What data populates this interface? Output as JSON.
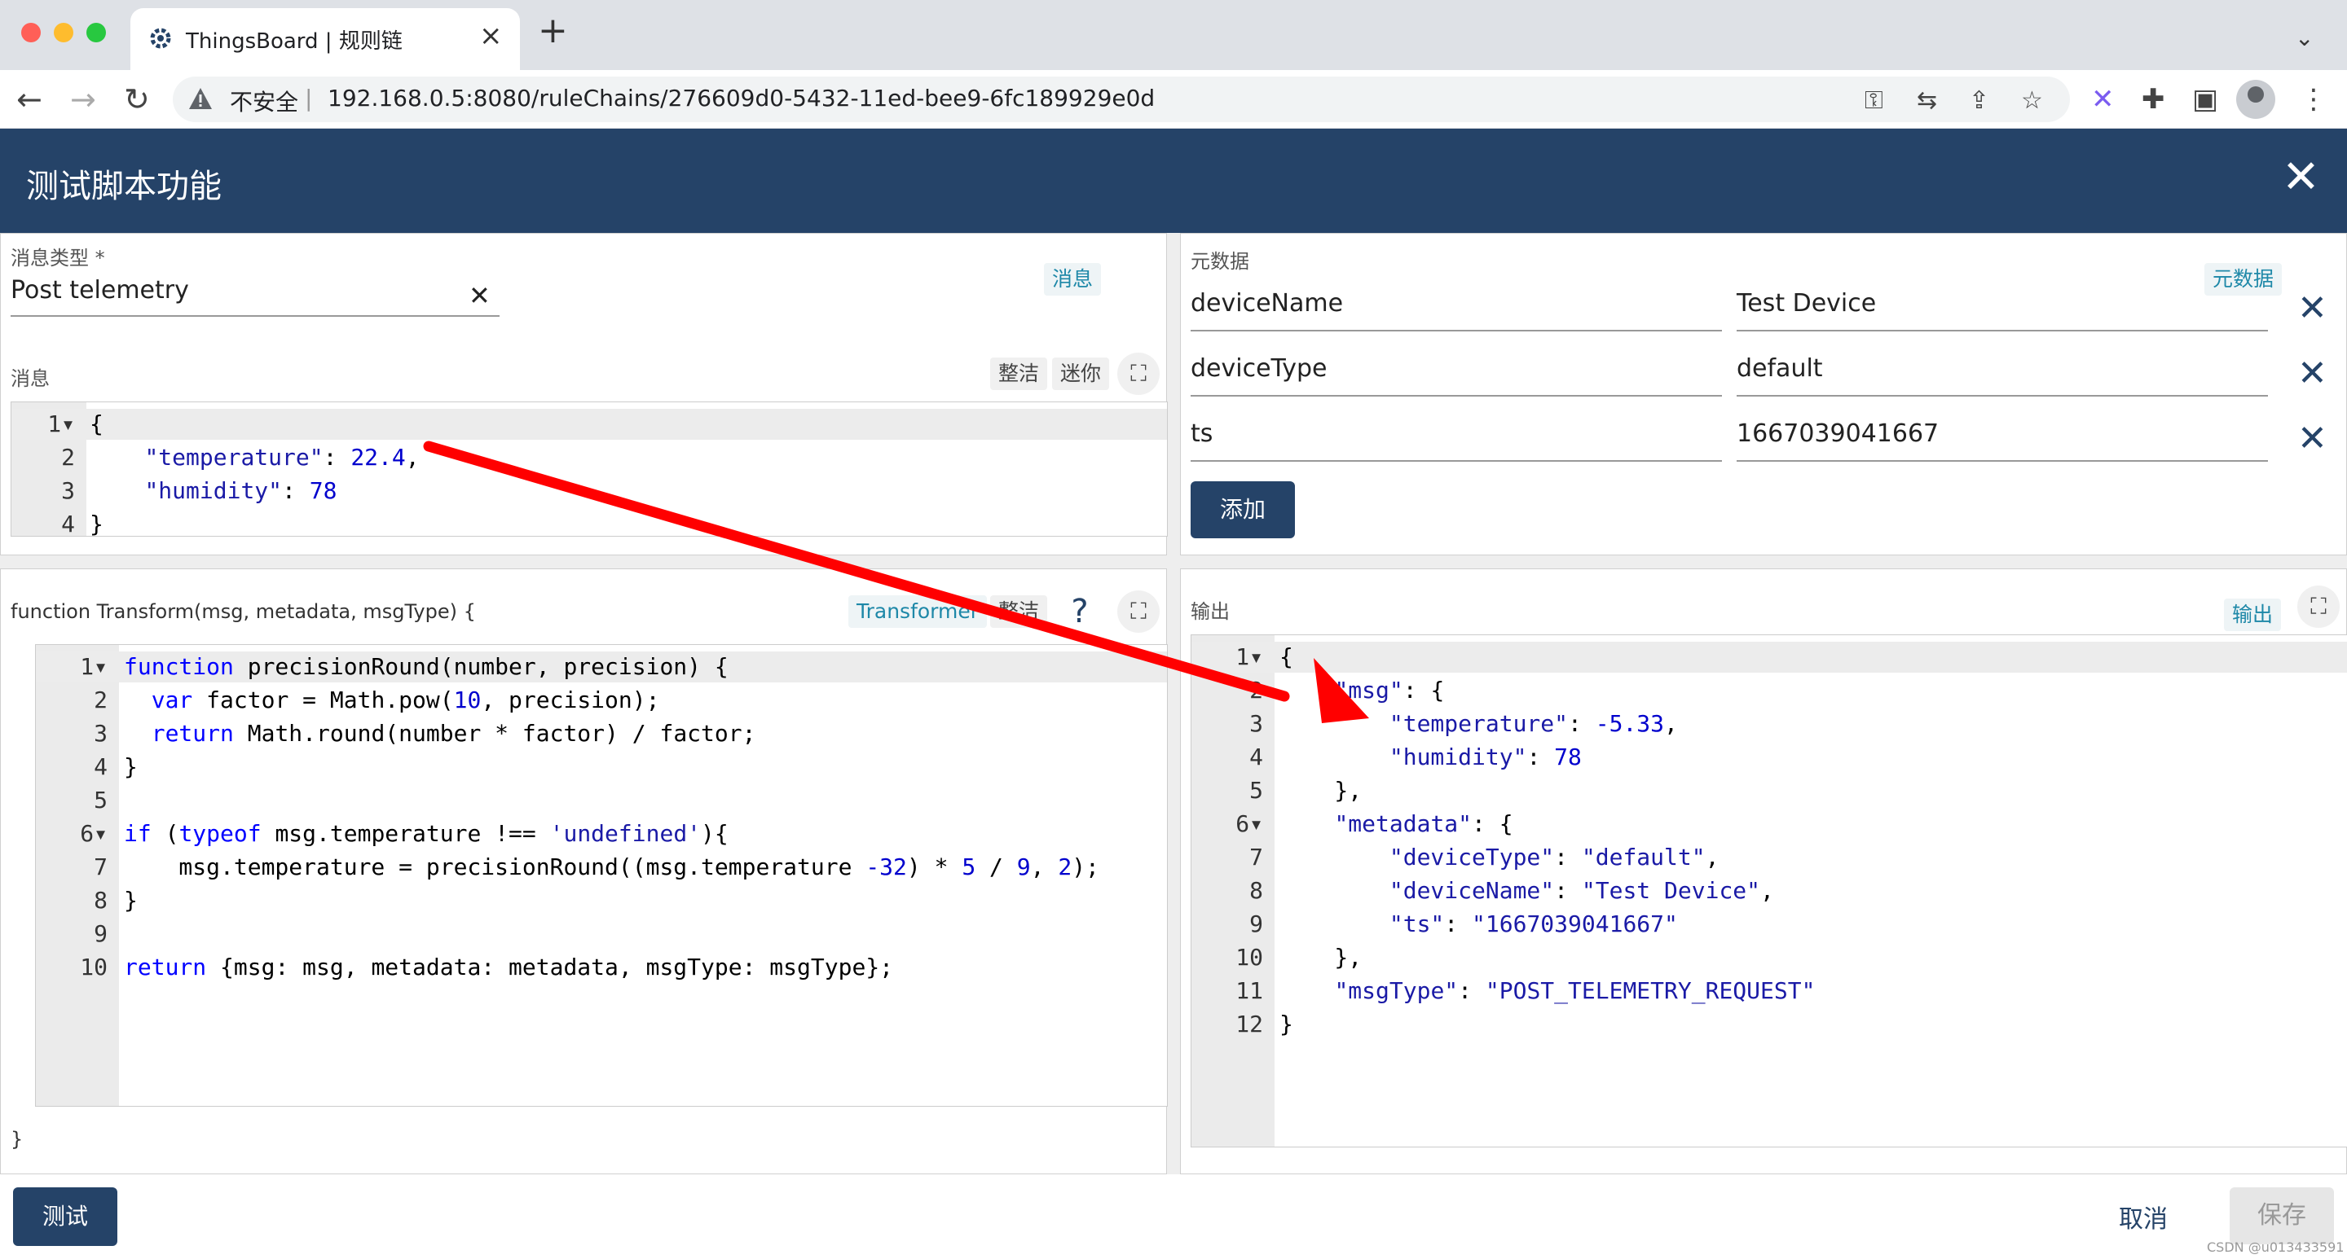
{
  "browser": {
    "tab_title": "ThingsBoard | 规则链",
    "insecure_label": "不安全",
    "url": "192.168.0.5:8080/ruleChains/276609d0-5432-11ed-bee9-6fc189929e0d"
  },
  "dialog": {
    "title": "测试脚本功能"
  },
  "message_panel": {
    "type_label": "消息类型 *",
    "type_value": "Post telemetry",
    "chip": "消息",
    "msg_label": "消息",
    "tidy_label": "整洁",
    "mini_label": "迷你",
    "code": [
      "{",
      "    \"temperature\": 22.4,",
      "    \"humidity\": 78",
      "}"
    ]
  },
  "metadata_panel": {
    "label": "元数据",
    "chip": "元数据",
    "rows": [
      {
        "key": "deviceName",
        "value": "Test Device"
      },
      {
        "key": "deviceType",
        "value": "default"
      },
      {
        "key": "ts",
        "value": "1667039041667"
      }
    ],
    "add_label": "添加"
  },
  "script_panel": {
    "signature": "function Transform(msg, metadata, msgType) {",
    "chip": "Transformer",
    "chip2": "整洁",
    "closing": "}",
    "code": [
      "function precisionRound(number, precision) {",
      "  var factor = Math.pow(10, precision);",
      "  return Math.round(number * factor) / factor;",
      "}",
      "",
      "if (typeof msg.temperature !== 'undefined'){",
      "    msg.temperature = precisionRound((msg.temperature -32) * 5 / 9, 2);",
      "}",
      "",
      "return {msg: msg, metadata: metadata, msgType: msgType};"
    ]
  },
  "output_panel": {
    "label": "输出",
    "chip": "输出",
    "code": [
      "{",
      "    \"msg\": {",
      "        \"temperature\": -5.33,",
      "        \"humidity\": 78",
      "    },",
      "    \"metadata\": {",
      "        \"deviceType\": \"default\",",
      "        \"deviceName\": \"Test Device\",",
      "        \"ts\": \"1667039041667\"",
      "    },",
      "    \"msgType\": \"POST_TELEMETRY_REQUEST\"",
      "}"
    ]
  },
  "footer": {
    "test_label": "测试",
    "cancel_label": "取消",
    "save_label": "保存",
    "watermark": "CSDN @u013433591"
  },
  "colors": {
    "header": "#254368",
    "accent": "#1e88a8",
    "arrow": "#ff0000"
  }
}
